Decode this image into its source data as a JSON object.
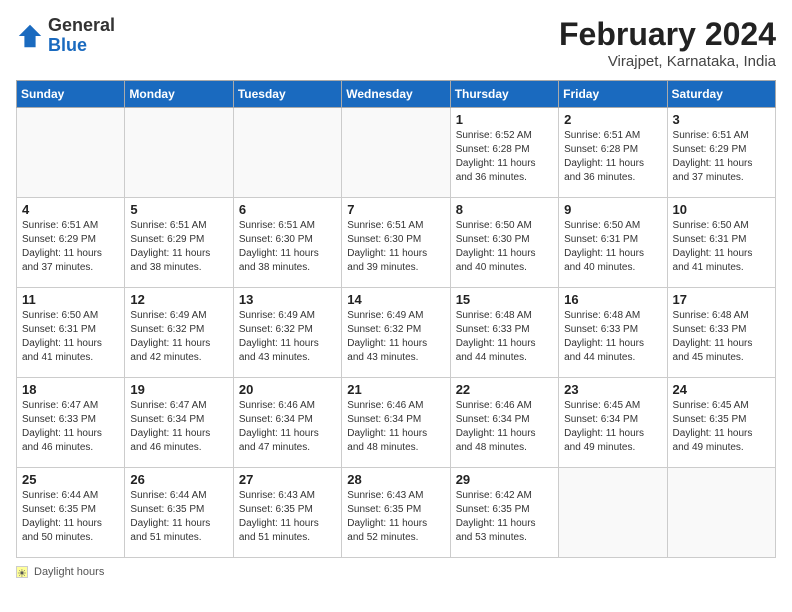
{
  "logo": {
    "general": "General",
    "blue": "Blue"
  },
  "title": "February 2024",
  "subtitle": "Virajpet, Karnataka, India",
  "days_of_week": [
    "Sunday",
    "Monday",
    "Tuesday",
    "Wednesday",
    "Thursday",
    "Friday",
    "Saturday"
  ],
  "footer_label": "Daylight hours",
  "weeks": [
    [
      {
        "day": "",
        "info": ""
      },
      {
        "day": "",
        "info": ""
      },
      {
        "day": "",
        "info": ""
      },
      {
        "day": "",
        "info": ""
      },
      {
        "day": "1",
        "info": "Sunrise: 6:52 AM\nSunset: 6:28 PM\nDaylight: 11 hours and 36 minutes."
      },
      {
        "day": "2",
        "info": "Sunrise: 6:51 AM\nSunset: 6:28 PM\nDaylight: 11 hours and 36 minutes."
      },
      {
        "day": "3",
        "info": "Sunrise: 6:51 AM\nSunset: 6:29 PM\nDaylight: 11 hours and 37 minutes."
      }
    ],
    [
      {
        "day": "4",
        "info": "Sunrise: 6:51 AM\nSunset: 6:29 PM\nDaylight: 11 hours and 37 minutes."
      },
      {
        "day": "5",
        "info": "Sunrise: 6:51 AM\nSunset: 6:29 PM\nDaylight: 11 hours and 38 minutes."
      },
      {
        "day": "6",
        "info": "Sunrise: 6:51 AM\nSunset: 6:30 PM\nDaylight: 11 hours and 38 minutes."
      },
      {
        "day": "7",
        "info": "Sunrise: 6:51 AM\nSunset: 6:30 PM\nDaylight: 11 hours and 39 minutes."
      },
      {
        "day": "8",
        "info": "Sunrise: 6:50 AM\nSunset: 6:30 PM\nDaylight: 11 hours and 40 minutes."
      },
      {
        "day": "9",
        "info": "Sunrise: 6:50 AM\nSunset: 6:31 PM\nDaylight: 11 hours and 40 minutes."
      },
      {
        "day": "10",
        "info": "Sunrise: 6:50 AM\nSunset: 6:31 PM\nDaylight: 11 hours and 41 minutes."
      }
    ],
    [
      {
        "day": "11",
        "info": "Sunrise: 6:50 AM\nSunset: 6:31 PM\nDaylight: 11 hours and 41 minutes."
      },
      {
        "day": "12",
        "info": "Sunrise: 6:49 AM\nSunset: 6:32 PM\nDaylight: 11 hours and 42 minutes."
      },
      {
        "day": "13",
        "info": "Sunrise: 6:49 AM\nSunset: 6:32 PM\nDaylight: 11 hours and 43 minutes."
      },
      {
        "day": "14",
        "info": "Sunrise: 6:49 AM\nSunset: 6:32 PM\nDaylight: 11 hours and 43 minutes."
      },
      {
        "day": "15",
        "info": "Sunrise: 6:48 AM\nSunset: 6:33 PM\nDaylight: 11 hours and 44 minutes."
      },
      {
        "day": "16",
        "info": "Sunrise: 6:48 AM\nSunset: 6:33 PM\nDaylight: 11 hours and 44 minutes."
      },
      {
        "day": "17",
        "info": "Sunrise: 6:48 AM\nSunset: 6:33 PM\nDaylight: 11 hours and 45 minutes."
      }
    ],
    [
      {
        "day": "18",
        "info": "Sunrise: 6:47 AM\nSunset: 6:33 PM\nDaylight: 11 hours and 46 minutes."
      },
      {
        "day": "19",
        "info": "Sunrise: 6:47 AM\nSunset: 6:34 PM\nDaylight: 11 hours and 46 minutes."
      },
      {
        "day": "20",
        "info": "Sunrise: 6:46 AM\nSunset: 6:34 PM\nDaylight: 11 hours and 47 minutes."
      },
      {
        "day": "21",
        "info": "Sunrise: 6:46 AM\nSunset: 6:34 PM\nDaylight: 11 hours and 48 minutes."
      },
      {
        "day": "22",
        "info": "Sunrise: 6:46 AM\nSunset: 6:34 PM\nDaylight: 11 hours and 48 minutes."
      },
      {
        "day": "23",
        "info": "Sunrise: 6:45 AM\nSunset: 6:34 PM\nDaylight: 11 hours and 49 minutes."
      },
      {
        "day": "24",
        "info": "Sunrise: 6:45 AM\nSunset: 6:35 PM\nDaylight: 11 hours and 49 minutes."
      }
    ],
    [
      {
        "day": "25",
        "info": "Sunrise: 6:44 AM\nSunset: 6:35 PM\nDaylight: 11 hours and 50 minutes."
      },
      {
        "day": "26",
        "info": "Sunrise: 6:44 AM\nSunset: 6:35 PM\nDaylight: 11 hours and 51 minutes."
      },
      {
        "day": "27",
        "info": "Sunrise: 6:43 AM\nSunset: 6:35 PM\nDaylight: 11 hours and 51 minutes."
      },
      {
        "day": "28",
        "info": "Sunrise: 6:43 AM\nSunset: 6:35 PM\nDaylight: 11 hours and 52 minutes."
      },
      {
        "day": "29",
        "info": "Sunrise: 6:42 AM\nSunset: 6:35 PM\nDaylight: 11 hours and 53 minutes."
      },
      {
        "day": "",
        "info": ""
      },
      {
        "day": "",
        "info": ""
      }
    ]
  ]
}
